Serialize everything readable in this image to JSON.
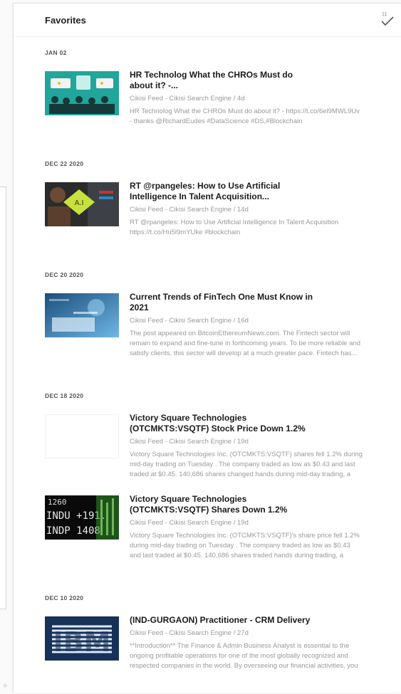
{
  "header": {
    "title": "Favorites",
    "unread_count": "11"
  },
  "sections": [
    {
      "date": "JAN 02",
      "entries": [
        {
          "title_line1": "HR Technolog What the CHROs Must do",
          "title_line2": "about it? -...",
          "meta": "Cikisi Feed - Cikisi Search Engine / 4d",
          "summary_line1": "HR Technolog What the CHROs Must do about it? - https://t.co/6el9MWL9Uv",
          "summary_line2": "- thanks @RichardEudes #DataScience #DS,#Blockchain",
          "summary_line3": ""
        }
      ]
    },
    {
      "date": "DEC 22 2020",
      "entries": [
        {
          "title_line1": "RT @rpangeles: How to Use Artificial",
          "title_line2": "Intelligence In Talent Acquisition...",
          "meta": "Cikisi Feed - Cikisi Search Engine / 14d",
          "summary_line1": "RT @rpangeles: How to Use Artificial Intelligence In Talent Acquisition",
          "summary_line2": "https://t.co/Hu5l9mYUke #blockchain",
          "summary_line3": "",
          "thumb_text": "A.I"
        }
      ]
    },
    {
      "date": "DEC 20 2020",
      "entries": [
        {
          "title_line1": "Current Trends of FinTech One Must Know in",
          "title_line2": "2021",
          "meta": "Cikisi Feed - Cikisi Search Engine / 16d",
          "summary_line1": "The post appeared on BitcoinEthereumNews.com. The Fintech sector will",
          "summary_line2": "remain to expand and fine-tune in forthcoming years. To be more reliable and",
          "summary_line3": "satisfy clients, this sector will develop at a much greater pace. Fintech has..."
        }
      ]
    },
    {
      "date": "DEC 18 2020",
      "entries": [
        {
          "title_line1": "Victory Square Technologies",
          "title_line2": "(OTCMKTS:VSQTF) Stock Price Down 1.2%",
          "meta": "Cikisi Feed - Cikisi Search Engine / 19d",
          "summary_line1": "Victory Square Technologies Inc. (OTCMKTS:VSQTF) shares fell 1.2% during",
          "summary_line2": "mid-day trading on Tuesday . The company traded as low as $0.43 and last",
          "summary_line3": "traded at $0.45. 140,686 shares changed hands during mid-day trading, a"
        },
        {
          "title_line1": "Victory Square Technologies",
          "title_line2": "(OTCMKTS:VSQTF) Shares Down 1.2%",
          "meta": "Cikisi Feed - Cikisi Search Engine / 19d",
          "summary_line1": "Victory Square Technologies Inc. (OTCMKTS:VSQTF)'s share price fell 1.2%",
          "summary_line2": "during mid-day trading on Tuesday . The company traded as low as $0.43",
          "summary_line3": "and last traded at $0.45. 140,686 shares traded hands during trading, a",
          "thumb_rows": [
            "1260",
            "INDU +191.",
            "INDP 1408"
          ]
        }
      ]
    },
    {
      "date": "DEC 10 2020",
      "entries": [
        {
          "title_line1": "(IND-GURGAON) Practitioner - CRM Delivery",
          "title_line2": "",
          "meta": "Cikisi Feed - Cikisi Search Engine / 27d",
          "summary_line1": "**Introduction** The Finance & Admin Business Analyst is essential to the",
          "summary_line2": "ongoing profitable operations for one of the most globally recognized and",
          "summary_line3": "respected companies in the world. By overseeing our financial activities, you",
          "thumb_text": "IBM"
        }
      ]
    }
  ],
  "colors": {
    "title": "#1a1a1a",
    "muted": "#9a9a9a",
    "ibm_blue": "#1f70c1"
  },
  "icons": {
    "mark_read": "checkmark-icon",
    "corner": "pin-icon"
  }
}
